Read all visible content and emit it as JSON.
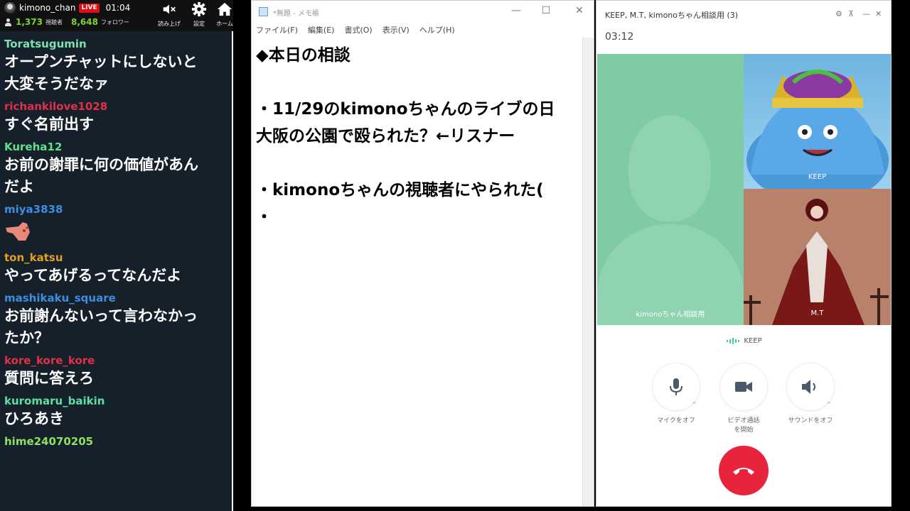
{
  "stream_header": {
    "channel_name": "kimono_chan",
    "live_badge": "LIVE",
    "elapsed": "01:04",
    "viewers": "1,373",
    "viewers_label": "視聴者",
    "followers": "8,648",
    "followers_label": "フォロワー",
    "buttons": [
      {
        "label": "読み上げ",
        "icon": "speaker-mute-icon"
      },
      {
        "label": "設定",
        "icon": "gear-icon"
      },
      {
        "label": "ホーム",
        "icon": "home-icon"
      }
    ]
  },
  "chat": {
    "messages": [
      {
        "user": "Toratsugumin",
        "color": "#7fe0b0",
        "text": "オープンチャットにしないと",
        "text2": "大変そうだなァ"
      },
      {
        "user": "richankilove1028",
        "color": "#e0304a",
        "text": "すぐ名前出す",
        "text2": ""
      },
      {
        "user": "Kureha12",
        "color": "#5fe08a",
        "text": "お前の謝罪に何の価値があん",
        "text2": "だよ"
      },
      {
        "user": "miya3838",
        "color": "#3a8fe0",
        "text": "",
        "text2": "",
        "emoji": "pointing-hand-emoji"
      },
      {
        "user": "ton_katsu",
        "color": "#e0a020",
        "text": "やってあげるってなんだよ",
        "text2": ""
      },
      {
        "user": "mashikaku_square",
        "color": "#3a8fe0",
        "text": "お前謝んないって言わなかっ",
        "text2": "たか？"
      },
      {
        "user": "kore_kore_kore",
        "color": "#e0304a",
        "text": "質問に答えろ",
        "text2": ""
      },
      {
        "user": "kuromaru_baikin",
        "color": "#5fe0a0",
        "text": "ひろあき",
        "text2": ""
      },
      {
        "user": "hime24070205",
        "color": "#8fe060",
        "text": "",
        "text2": ""
      }
    ]
  },
  "notepad": {
    "title": "*無題 - メモ帳",
    "menu": [
      "ファイル(F)",
      "編集(E)",
      "書式(O)",
      "表示(V)",
      "ヘルプ(H)"
    ],
    "lines": [
      "◆本日の相談",
      "",
      "・11/29のkimonoちゃんのライブの日",
      "大阪の公園で殴られた？←リスナー",
      "",
      "・kimonoちゃんの視聴者にやられた(",
      "・"
    ]
  },
  "call": {
    "title": "KEEP, M.T, kimonoちゃん相談用  (3)",
    "timer": "03:12",
    "participants": [
      {
        "name": "kimonoちゃん相談用"
      },
      {
        "name": "KEEP"
      },
      {
        "name": "M.T"
      }
    ],
    "speaking": "KEEP",
    "controls": [
      {
        "label": "マイクをオフ",
        "icon": "microphone-icon"
      },
      {
        "label": "ビデオ通話を開始",
        "icon": "video-camera-icon"
      },
      {
        "label": "サウンドをオフ",
        "icon": "speaker-icon"
      }
    ],
    "end_call_icon": "phone-hangup-icon"
  }
}
